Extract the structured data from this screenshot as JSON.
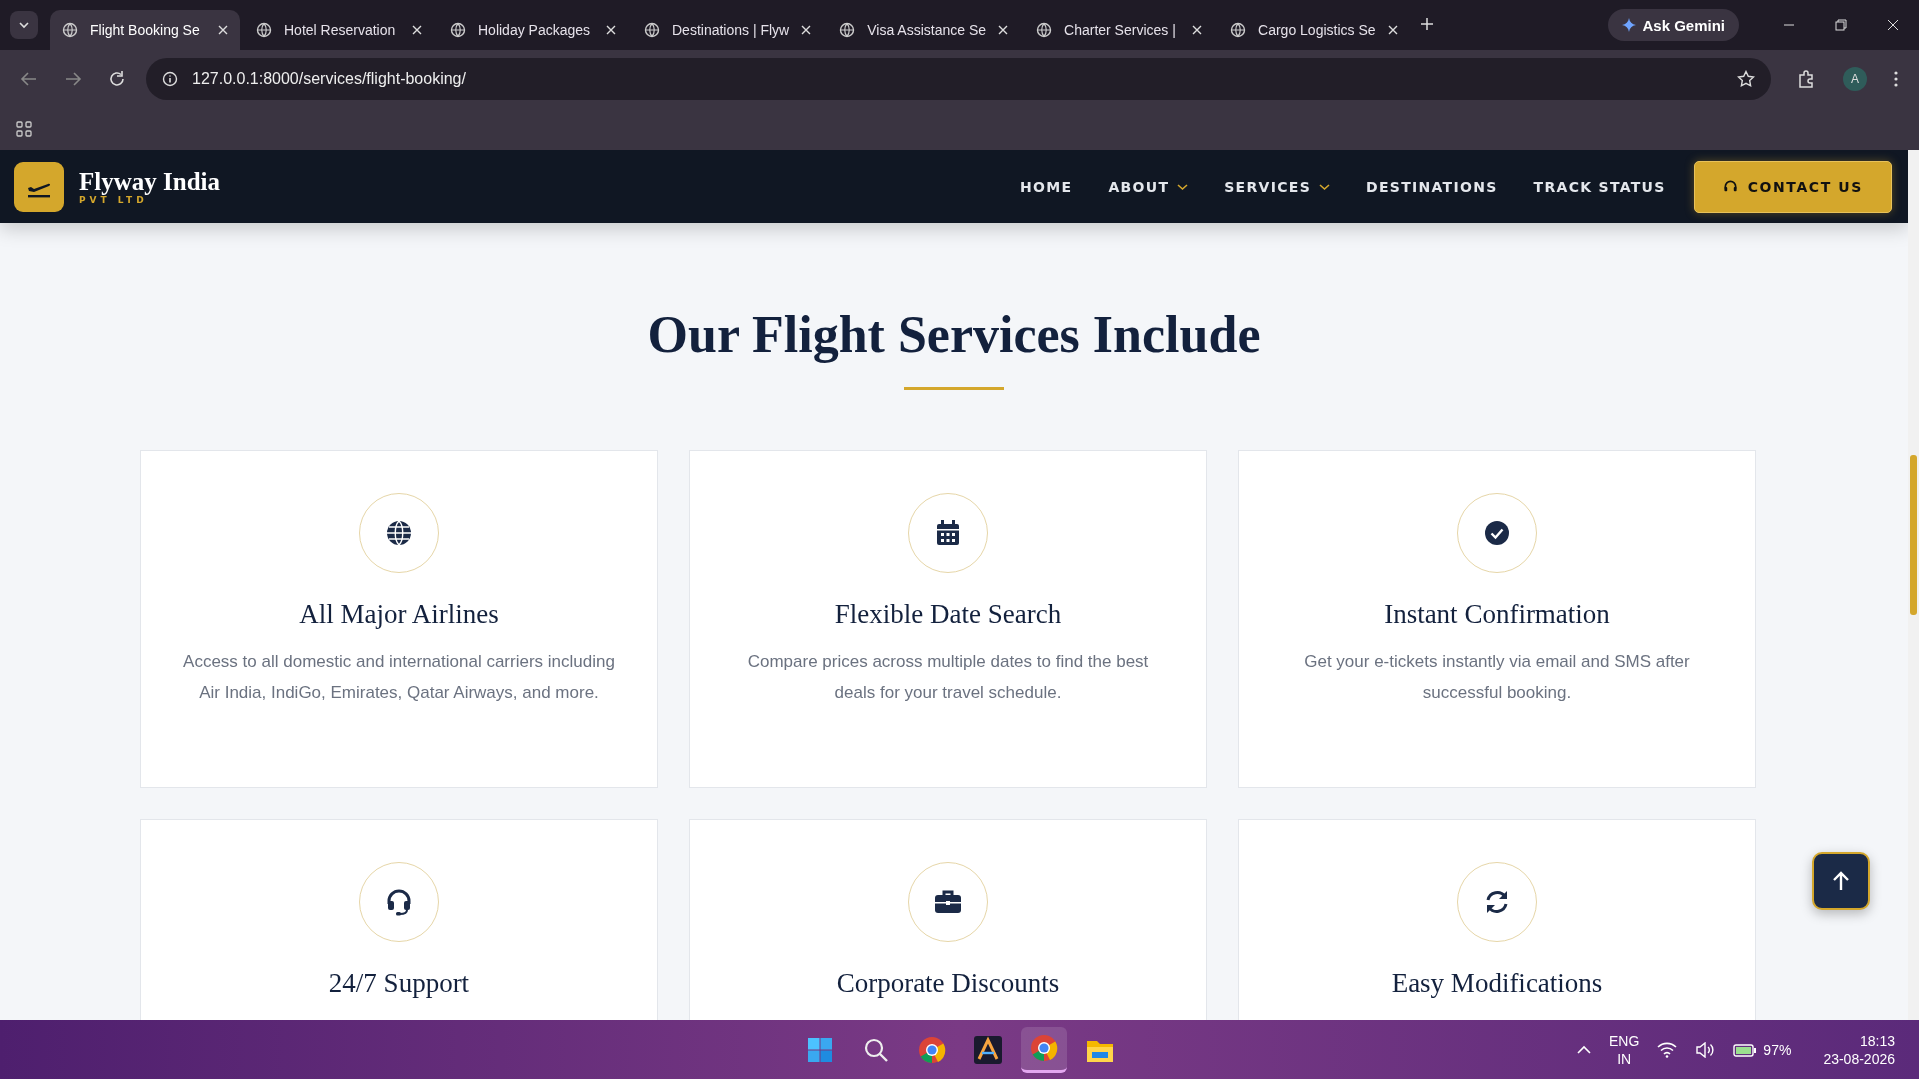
{
  "browser": {
    "tabs": [
      {
        "title": "Flight Booking Se",
        "selected": true
      },
      {
        "title": "Hotel Reservation",
        "selected": false
      },
      {
        "title": "Holiday Packages",
        "selected": false
      },
      {
        "title": "Destinations | Flyw",
        "selected": false
      },
      {
        "title": "Visa Assistance Se",
        "selected": false
      },
      {
        "title": "Charter Services |",
        "selected": false
      },
      {
        "title": "Cargo Logistics Se",
        "selected": false
      }
    ],
    "ask_button": "Ask Gemini",
    "url": "127.0.0.1:8000/services/flight-booking/",
    "profile_initial": "A"
  },
  "navbar": {
    "brand": "Flyway India",
    "brand_sub": "PVT LTD",
    "links": [
      {
        "label": "HOME",
        "dropdown": false
      },
      {
        "label": "ABOUT",
        "dropdown": true
      },
      {
        "label": "SERVICES",
        "dropdown": true
      },
      {
        "label": "DESTINATIONS",
        "dropdown": false
      },
      {
        "label": "TRACK STATUS",
        "dropdown": false
      }
    ],
    "contact": "CONTACT US"
  },
  "section": {
    "title": "Our Flight Services Include",
    "cards": [
      {
        "kind": "globe",
        "title": "All Major Airlines",
        "description": "Access to all domestic and international carriers including Air India, IndiGo, Emirates, Qatar Airways, and more."
      },
      {
        "kind": "calendar",
        "title": "Flexible Date Search",
        "description": "Compare prices across multiple dates to find the best deals for your travel schedule."
      },
      {
        "kind": "check",
        "title": "Instant Confirmation",
        "description": "Get your e-tickets instantly via email and SMS after successful booking."
      },
      {
        "kind": "headset",
        "title": "24/7 Support"
      },
      {
        "kind": "briefcase",
        "title": "Corporate Discounts"
      },
      {
        "kind": "sync",
        "title": "Easy Modifications"
      }
    ]
  },
  "taskbar": {
    "apps": [
      {
        "kind": "start",
        "active": false
      },
      {
        "kind": "search",
        "active": false
      },
      {
        "kind": "chrome",
        "active": false
      },
      {
        "kind": "editor",
        "active": false
      },
      {
        "kind": "chrome",
        "active": true
      },
      {
        "kind": "files",
        "active": false
      }
    ],
    "language": "ENG",
    "region": "IN",
    "battery": "97%",
    "time": "18:13",
    "date": "23-08-2026"
  }
}
